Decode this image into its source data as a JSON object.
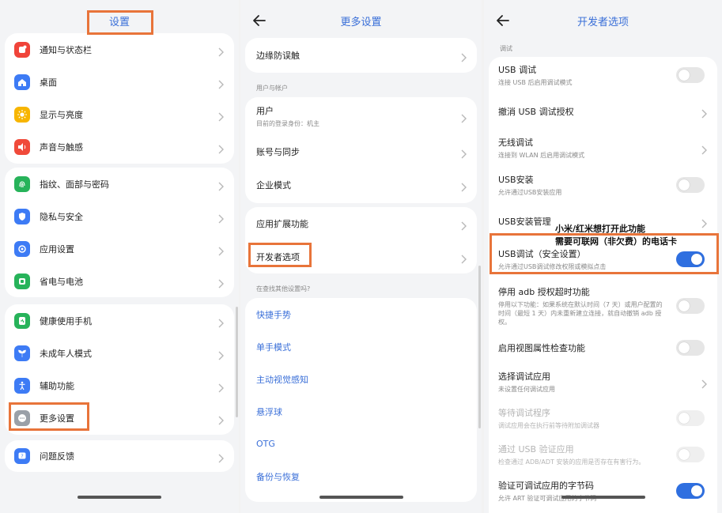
{
  "colors": {
    "accent": "#3a6fd8",
    "highlight": "#e8743a",
    "toggle_on": "#2f6fe0"
  },
  "panel1": {
    "title": "设置",
    "group1": [
      {
        "label": "通知与状态栏",
        "icon": "notification-icon",
        "color": "#f0443a"
      },
      {
        "label": "桌面",
        "icon": "home-icon",
        "color": "#3d7bf5"
      },
      {
        "label": "显示与亮度",
        "icon": "sun-icon",
        "color": "#f7b500"
      },
      {
        "label": "声音与触感",
        "icon": "speaker-icon",
        "color": "#f04a3a"
      }
    ],
    "group2": [
      {
        "label": "指纹、面部与密码",
        "icon": "fingerprint-icon",
        "color": "#27b35a"
      },
      {
        "label": "隐私与安全",
        "icon": "shield-icon",
        "color": "#3d7bf5"
      },
      {
        "label": "应用设置",
        "icon": "apps-icon",
        "color": "#3d7bf5"
      },
      {
        "label": "省电与电池",
        "icon": "battery-icon",
        "color": "#27b35a"
      }
    ],
    "group3": [
      {
        "label": "健康使用手机",
        "icon": "health-icon",
        "color": "#27b35a"
      },
      {
        "label": "未成年人模式",
        "icon": "sprout-icon",
        "color": "#3d7bf5"
      },
      {
        "label": "辅助功能",
        "icon": "accessibility-icon",
        "color": "#3d7bf5"
      },
      {
        "label": "更多设置",
        "icon": "more-icon",
        "color": "#9aa0a8"
      }
    ],
    "group4": [
      {
        "label": "问题反馈",
        "icon": "feedback-icon",
        "color": "#3d7bf5"
      }
    ]
  },
  "panel2": {
    "title": "更多设置",
    "top_item": "边缘防误触",
    "section_user": "用户与帐户",
    "user_label": "用户",
    "user_sub": "目前的登录身份：机主",
    "account_sync": "账号与同步",
    "enterprise": "企业模式",
    "app_ext": "应用扩展功能",
    "dev_options": "开发者选项",
    "section_search": "在查找其他设置吗?",
    "links": [
      "快捷手势",
      "单手模式",
      "主动视觉感知",
      "悬浮球",
      "OTG",
      "备份与恢复"
    ]
  },
  "panel3": {
    "title": "开发者选项",
    "section_debug": "调试",
    "usb_debug": "USB 调试",
    "usb_debug_sub": "连接 USB 后启用调试模式",
    "revoke_usb": "撤消 USB 调试授权",
    "wireless_debug": "无线调试",
    "wireless_debug_sub": "连接到 WLAN 后启用调试模式",
    "usb_install": "USB安装",
    "usb_install_sub": "允许通过USB安装应用",
    "usb_install_mgmt": "USB安装管理",
    "usb_debug_secure": "USB调试（安全设置）",
    "usb_debug_secure_sub": "允许通过USB调试修改权限或模拟点击",
    "adb_timeout": "停用 adb 授权超时功能",
    "adb_timeout_sub": "停用以下功能：如果系统在默认时间（7 天）或用户配置的时间（最短 1 天）内未重新建立连接，就自动撤销 adb 授权。",
    "view_attr": "启用视图属性检查功能",
    "select_debug_app": "选择调试应用",
    "select_debug_app_sub": "未设置任何调试应用",
    "wait_debugger": "等待调试程序",
    "wait_debugger_sub": "调试应用会在执行前等待附加调试器",
    "verify_usb_apps": "通过 USB 验证应用",
    "verify_usb_apps_sub": "检查通过 ADB/ADT 安装的应用是否存在有害行为。",
    "verify_bytecode": "验证可调试应用的字节码",
    "verify_bytecode_sub": "允许 ART 验证可调试应用的字节码"
  },
  "annotation": {
    "line1": "小米/红米想打开此功能",
    "line2": "需要可联网（非欠费）的电话卡"
  }
}
